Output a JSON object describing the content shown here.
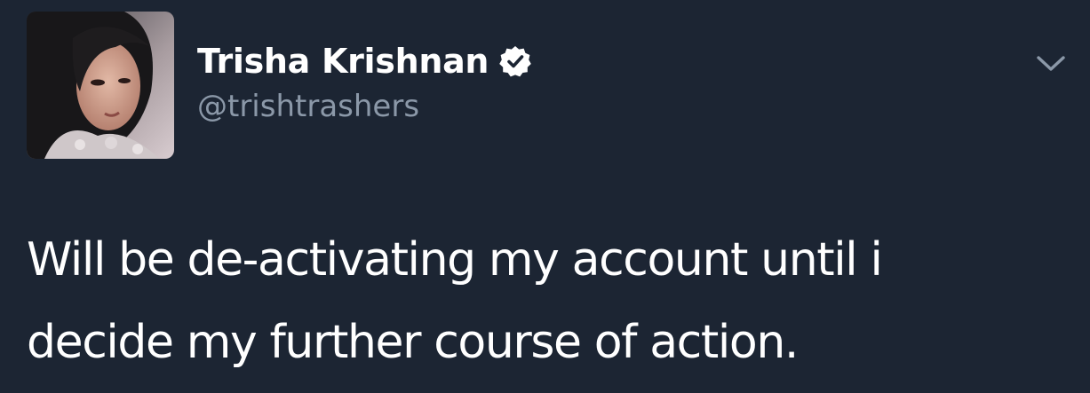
{
  "tweet": {
    "display_name": "Trisha Krishnan",
    "handle": "@trishtrashers",
    "verified": true,
    "text_line_1": "Will be de-activating my account until i",
    "text_line_2": "decide my further course of action."
  },
  "icons": {
    "verified": "verified-badge-icon",
    "menu": "chevron-down-icon"
  },
  "colors": {
    "background": "#1c2533",
    "name": "#ffffff",
    "handle": "#8b98a8",
    "text": "#ffffff",
    "chevron": "#8b98a8"
  }
}
